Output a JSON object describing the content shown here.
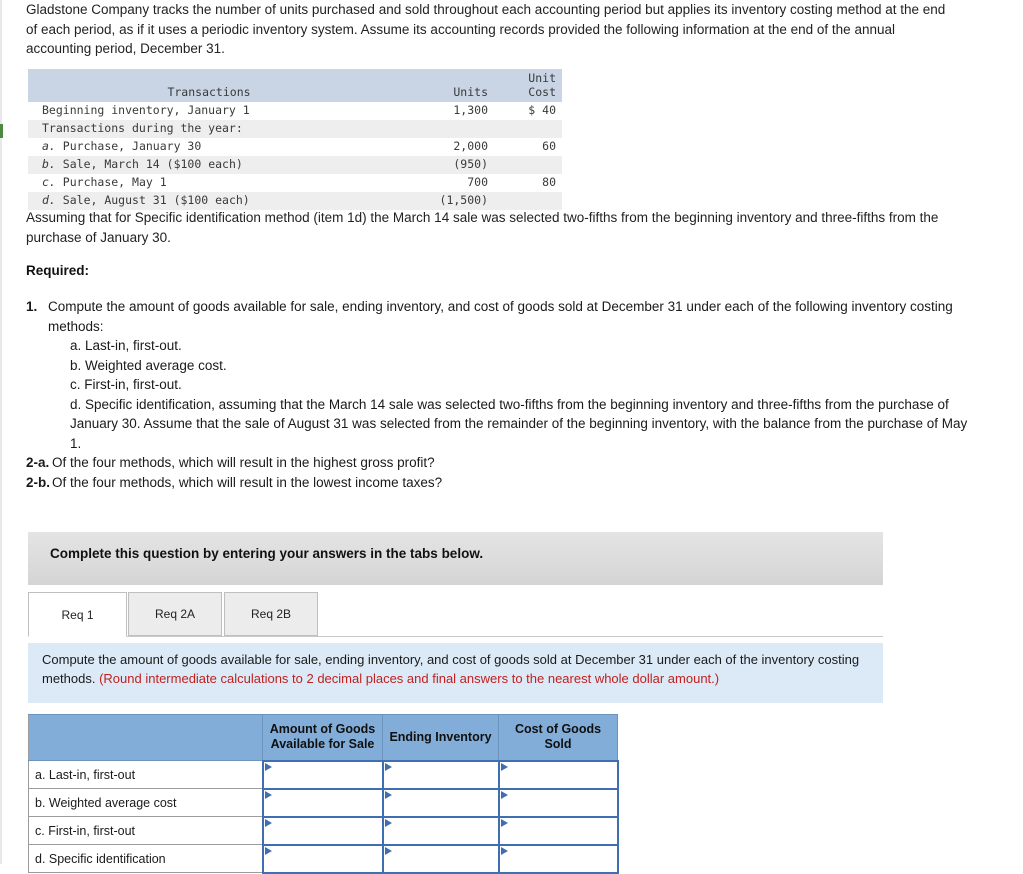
{
  "intro": {
    "text": "Gladstone Company tracks the number of units purchased and sold throughout each accounting period but applies its inventory costing method at the end of each period, as if it uses a periodic inventory system. Assume its accounting records provided the following information at the end of the annual accounting period, December 31."
  },
  "transactions_table": {
    "headers": {
      "transactions": "Transactions",
      "units": "Units",
      "unit_cost_line1": "Unit",
      "unit_cost_line2": "Cost"
    },
    "rows": [
      {
        "label": "Beginning inventory, January 1",
        "prefix": "",
        "units": "1,300",
        "cost": "$ 40",
        "shaded": false
      },
      {
        "label": "Transactions during the year:",
        "prefix": "",
        "units": "",
        "cost": "",
        "shaded": true
      },
      {
        "label": "Purchase, January 30",
        "prefix": "a.",
        "units": "2,000",
        "cost": "60",
        "shaded": false
      },
      {
        "label": "Sale, March 14 ($100 each)",
        "prefix": "b.",
        "units": "(950)",
        "cost": "",
        "shaded": true
      },
      {
        "label": "Purchase, May 1",
        "prefix": "c.",
        "units": "700",
        "cost": "80",
        "shaded": false
      },
      {
        "label": "Sale, August 31 ($100 each)",
        "prefix": "d.",
        "units": "(1,500)",
        "cost": "",
        "shaded": true
      }
    ]
  },
  "assumption": {
    "text": "Assuming that for Specific identification method (item 1d) the March 14 sale was selected two-fifths from the beginning inventory and three-fifths from the purchase of January 30."
  },
  "required": {
    "heading": "Required:",
    "item1_number": "1.",
    "item1_text": "Compute the amount of goods available for sale, ending inventory, and cost of goods sold at December 31 under each of the following inventory costing methods:",
    "subitems": [
      "a. Last-in, first-out.",
      "b. Weighted average cost.",
      "c. First-in, first-out.",
      "d. Specific identification, assuming that the March 14 sale was selected two-fifths from the beginning inventory and three-fifths from the purchase of January 30. Assume that the sale of August 31 was selected from the remainder of the beginning inventory, with the balance from the purchase of May 1."
    ],
    "item2a_number": "2-a.",
    "item2a_text": "Of the four methods, which will result in the highest gross profit?",
    "item2b_number": "2-b.",
    "item2b_text": "Of the four methods, which will result in the lowest income taxes?"
  },
  "banner": {
    "text": "Complete this question by entering your answers in the tabs below."
  },
  "tabs": {
    "items": [
      {
        "label": "Req 1",
        "active": true
      },
      {
        "label": "Req 2A",
        "active": false
      },
      {
        "label": "Req 2B",
        "active": false
      }
    ]
  },
  "instruction": {
    "main": "Compute the amount of goods available for sale, ending inventory, and cost of goods sold at December 31 under each of the inventory costing methods. ",
    "note": "(Round intermediate calculations to 2 decimal places and final answers to the nearest whole dollar amount.)"
  },
  "answer_table": {
    "headers": {
      "blank": "",
      "agas_line1": "Amount of Goods",
      "agas_line2": "Available for Sale",
      "ending_inventory": "Ending Inventory",
      "cogs_line1": "Cost of Goods",
      "cogs_line2": "Sold"
    },
    "rows": [
      {
        "label": "a. Last-in, first-out",
        "agas": "",
        "ei": "",
        "cogs": ""
      },
      {
        "label": "b. Weighted average cost",
        "agas": "",
        "ei": "",
        "cogs": ""
      },
      {
        "label": "c. First-in, first-out",
        "agas": "",
        "ei": "",
        "cogs": ""
      },
      {
        "label": "d. Specific identification",
        "agas": "",
        "ei": "",
        "cogs": ""
      }
    ]
  },
  "colors": {
    "table_header_blue": "#82add9",
    "instruction_panel_blue": "#dceaf7",
    "note_red": "#c0211f",
    "txn_header_blue": "#c9d4e4",
    "cell_border_blue": "#3f6fb0"
  }
}
